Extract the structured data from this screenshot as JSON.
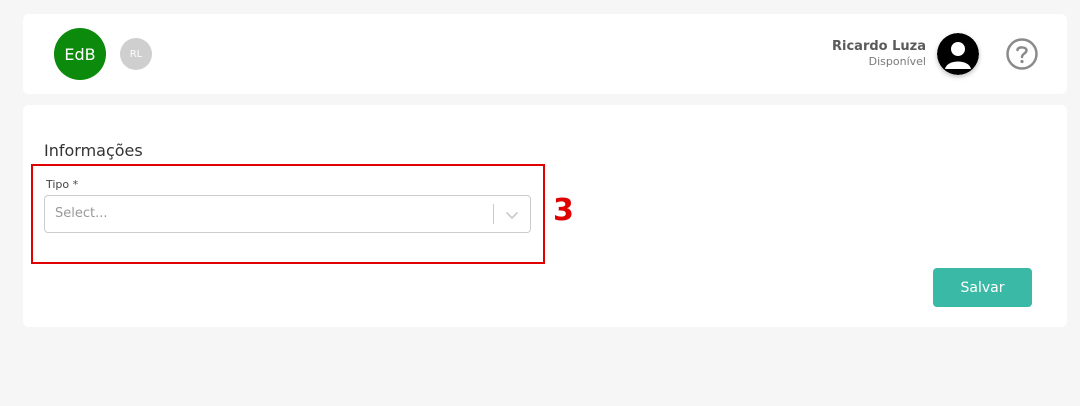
{
  "header": {
    "avatar_primary": "EdB",
    "avatar_secondary": "RL",
    "user_name": "Ricardo Luza",
    "user_status": "Disponível",
    "help_icon": "question-circle-icon",
    "user_photo_icon": "user-silhouette-icon"
  },
  "form": {
    "section_title": "Informações",
    "tipo_label": "Tipo *",
    "tipo_placeholder": "Select...",
    "annotation_number": "3",
    "save_label": "Salvar"
  },
  "colors": {
    "avatar_primary_bg": "#0b8a0b",
    "avatar_secondary_bg": "#cfcfcf",
    "save_button_bg": "#3abaa6",
    "highlight": "#e00000"
  }
}
